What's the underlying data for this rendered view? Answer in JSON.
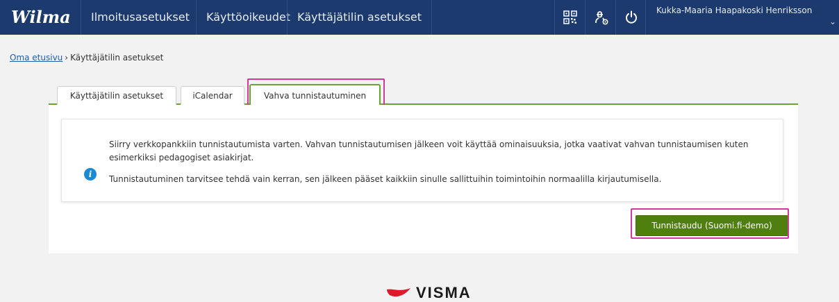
{
  "app": {
    "logo": "Wilma",
    "user_name": "Kukka-Maaria Haapakoski Henriksson"
  },
  "nav": {
    "items": [
      "Ilmoitusasetukset",
      "Käyttöoikeudet",
      "Käyttäjätilin asetukset"
    ],
    "icons": [
      "qr-code-icon",
      "role-settings-icon",
      "power-icon"
    ]
  },
  "breadcrumb": {
    "home": "Oma etusivu",
    "separator": "›",
    "current": "Käyttäjätilin asetukset"
  },
  "tabs": [
    {
      "label": "Käyttäjätilin asetukset",
      "active": false
    },
    {
      "label": "iCalendar",
      "active": false
    },
    {
      "label": "Vahva tunnistautuminen",
      "active": true
    }
  ],
  "info": {
    "paragraph1": "Siirry verkkopankkiin tunnistautumista varten. Vahvan tunnistautumisen jälkeen voit käyttää ominaisuuksia, jotka vaativat vahvan tunnistaumisen kuten esimerkiksi pedagogiset asiakirjat.",
    "paragraph2": "Tunnistautuminen tarvitsee tehdä vain kerran, sen jälkeen pääset kaikkiin sinulle sallittuihin toimintoihin normaalilla kirjautumisella."
  },
  "actions": {
    "authenticate_label": "Tunnistaudu (Suomi.fi-demo)"
  },
  "footer": {
    "brand": "VISMA"
  },
  "colors": {
    "nav_bg": "#1c3a6d",
    "accent_green": "#6aa42f",
    "button_green": "#4f7f0f",
    "highlight_pink": "#d13a9a",
    "link_blue": "#1f5fa8",
    "visma_red": "#e3172c"
  }
}
